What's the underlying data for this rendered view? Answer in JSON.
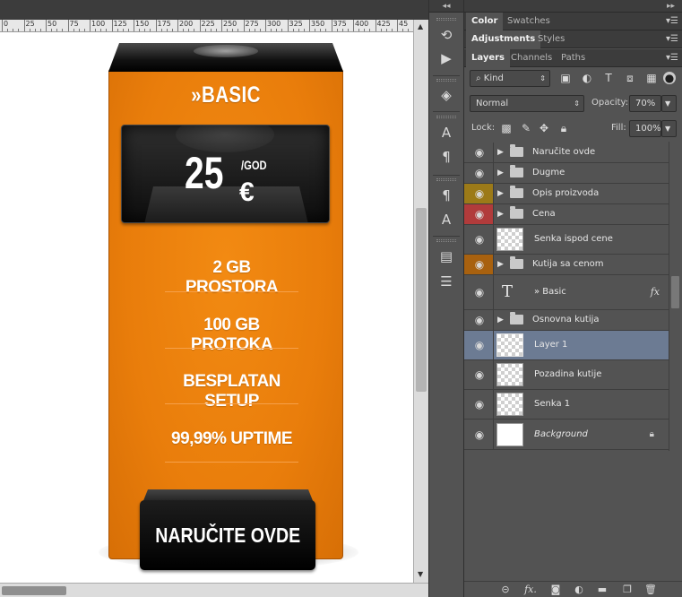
{
  "ruler": {
    "labels": [
      "0",
      "25",
      "50",
      "75",
      "100",
      "125",
      "150",
      "175",
      "200",
      "225",
      "250",
      "275",
      "300",
      "325",
      "350",
      "375",
      "400",
      "425",
      "45"
    ]
  },
  "canvas": {
    "plan_name": "»BASIC",
    "price": "25",
    "currency": "€",
    "period": "/GOD",
    "features": [
      "2 GB PROSTORA",
      "100 GB PROTOKA",
      "BESPLATAN SETUP",
      "99,99% UPTIME"
    ],
    "order_button": "NARUČITE OVDE",
    "colors": {
      "box": "#e97d0b",
      "dark": "#111111",
      "text": "#ffffff"
    }
  },
  "toolstrip": {
    "collapse": "◂◂",
    "icons": [
      "history-icon",
      "play-action-icon",
      "3d-cube-icon",
      "character-icon",
      "paragraph-icon",
      "character-style-icon",
      "paragraph-style-icon",
      "notes-icon",
      "properties-icon"
    ]
  },
  "panels": {
    "collapse": "▸▸",
    "group1": {
      "tabs": [
        "Color",
        "Swatches"
      ]
    },
    "group2": {
      "tabs": [
        "Adjustments",
        "Styles"
      ]
    },
    "group3": {
      "tabs": [
        "Layers",
        "Channels",
        "Paths"
      ]
    },
    "layers": {
      "filter_kind": "Kind",
      "blend_mode": "Normal",
      "opacity_label": "Opacity:",
      "opacity_value": "70%",
      "lock_label": "Lock:",
      "fill_label": "Fill:",
      "fill_value": "100%",
      "items": [
        {
          "name": "Naručite ovde",
          "type": "group",
          "vis_color": ""
        },
        {
          "name": "Dugme",
          "type": "group",
          "vis_color": ""
        },
        {
          "name": "Opis proizvoda",
          "type": "group",
          "vis_color": "#9c7a18"
        },
        {
          "name": "Cena",
          "type": "group",
          "vis_color": "#b13b3b"
        },
        {
          "name": "Senka ispod cene",
          "type": "pixel",
          "vis_color": ""
        },
        {
          "name": "Kutija sa cenom",
          "type": "group",
          "vis_color": "#a8610f"
        },
        {
          "name": "» Basic",
          "type": "text",
          "vis_color": "",
          "fx": "fx"
        },
        {
          "name": "Osnovna kutija",
          "type": "group",
          "vis_color": ""
        },
        {
          "name": "Layer 1",
          "type": "pixel",
          "vis_color": "",
          "selected": true
        },
        {
          "name": "Pozadina kutije",
          "type": "pixel",
          "vis_color": ""
        },
        {
          "name": "Senka 1",
          "type": "pixel",
          "vis_color": ""
        },
        {
          "name": "Background",
          "type": "background",
          "vis_color": "",
          "locked": true
        }
      ]
    },
    "footer_icons": [
      "link-layers-icon",
      "layer-style-icon",
      "layer-mask-icon",
      "adjustment-layer-icon",
      "new-group-icon",
      "new-layer-icon",
      "delete-layer-icon"
    ]
  }
}
